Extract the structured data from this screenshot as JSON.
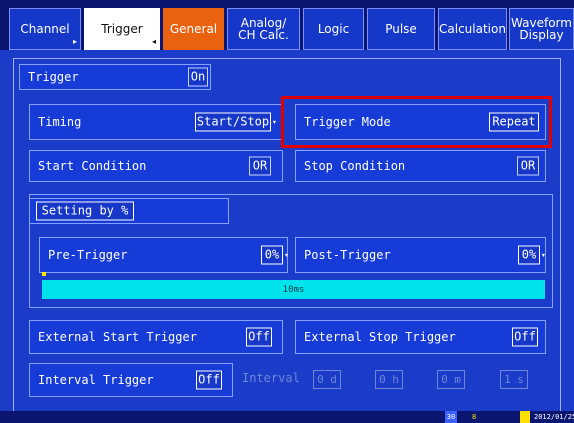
{
  "tabs": [
    {
      "label": "Channel"
    },
    {
      "label": "Trigger"
    },
    {
      "label": "General"
    },
    {
      "label": "Analog/\nCH Calc."
    },
    {
      "label": "Logic"
    },
    {
      "label": "Pulse"
    },
    {
      "label": "Calculation"
    },
    {
      "label": "Waveform\nDisplay"
    }
  ],
  "trigger": {
    "label": "Trigger",
    "value": "On"
  },
  "timing": {
    "label": "Timing",
    "value": "Start/Stop"
  },
  "trigger_mode": {
    "label": "Trigger Mode",
    "value": "Repeat"
  },
  "start_condition": {
    "label": "Start Condition",
    "value": "OR"
  },
  "stop_condition": {
    "label": "Stop Condition",
    "value": "OR"
  },
  "setting_by": {
    "label": "Setting by %"
  },
  "pre_trigger": {
    "label": "Pre-Trigger",
    "value": "0%"
  },
  "post_trigger": {
    "label": "Post-Trigger",
    "value": "0%"
  },
  "time_bar": {
    "label": "10ms"
  },
  "external_start": {
    "label": "External Start Trigger",
    "value": "Off"
  },
  "external_stop": {
    "label": "External Stop Trigger",
    "value": "Off"
  },
  "interval_trigger": {
    "label": "Interval Trigger",
    "value": "Off"
  },
  "interval": {
    "label": "Interval",
    "d": "0 d",
    "h": "0 h",
    "m": "0 m",
    "s": "1 s"
  },
  "status": {
    "a": "30",
    "b": "8",
    "date": "2012/01/25"
  }
}
